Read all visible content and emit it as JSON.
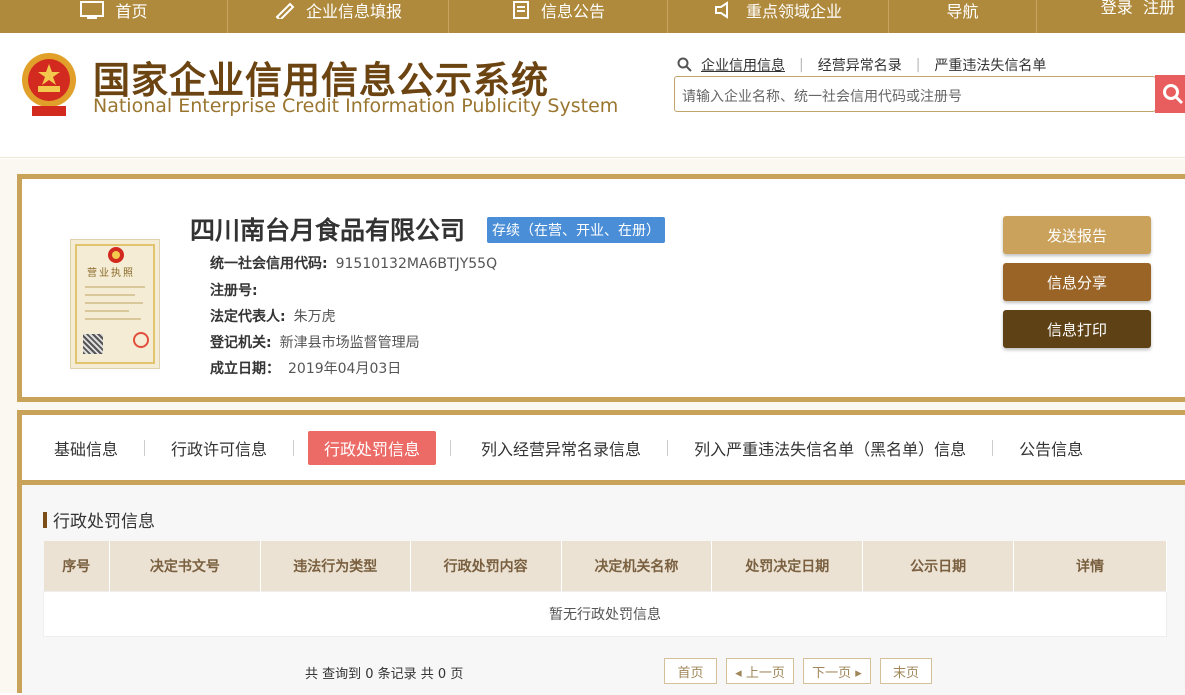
{
  "nav": {
    "items": [
      "首页",
      "企业信息填报",
      "信息公告",
      "重点领域企业",
      "导航"
    ],
    "login": "登录",
    "register": "注册"
  },
  "header": {
    "title_cn": "国家企业信用信息公示系统",
    "title_en": "National Enterprise Credit Information Publicity System",
    "quick_links": [
      "企业信用信息",
      "经营异常名录",
      "严重违法失信名单"
    ],
    "search_placeholder": "请输入企业名称、统一社会信用代码或注册号"
  },
  "company": {
    "name": "四川南台月食品有限公司",
    "status": "存续（在营、开业、在册）",
    "license_title": "营业执照",
    "fields": [
      {
        "label": "统一社会信用代码:",
        "value": "91510132MA6BTJY55Q"
      },
      {
        "label": "注册号:",
        "value": ""
      },
      {
        "label": "法定代表人:",
        "value": "朱万虎"
      },
      {
        "label": "登记机关:",
        "value": "新津县市场监督管理局"
      },
      {
        "label": "成立日期：",
        "value": "2019年04月03日"
      }
    ],
    "buttons": [
      "发送报告",
      "信息分享",
      "信息打印"
    ]
  },
  "tabs": {
    "items": [
      "基础信息",
      "行政许可信息",
      "行政处罚信息",
      "列入经营异常名录信息",
      "列入严重违法失信名单（黑名单）信息",
      "公告信息"
    ],
    "active": "行政处罚信息"
  },
  "section": {
    "title": "行政处罚信息",
    "columns": [
      "序号",
      "决定书文号",
      "违法行为类型",
      "行政处罚内容",
      "决定机关名称",
      "处罚决定日期",
      "公示日期",
      "详情"
    ],
    "empty_text": "暂无行政处罚信息",
    "count_text": "共 查询到 0 条记录 共 0 页",
    "pager": [
      "首页",
      "◂ 上一页",
      "下一页 ▸",
      "末页"
    ]
  },
  "colors": {
    "brand_gold": "#b08a3c",
    "title_brown": "#6b4412",
    "status_blue": "#4a8ed7",
    "active_tab": "#ec6b67"
  }
}
